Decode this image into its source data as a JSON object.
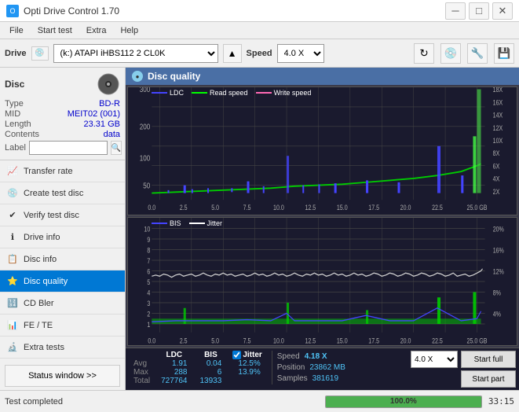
{
  "window": {
    "title": "Opti Drive Control 1.70",
    "icon": "disc"
  },
  "title_bar": {
    "controls": {
      "minimize": "─",
      "maximize": "□",
      "close": "✕"
    }
  },
  "menu": {
    "items": [
      "File",
      "Start test",
      "Extra",
      "Help"
    ]
  },
  "toolbar": {
    "drive_label": "Drive",
    "drive_icon": "💿",
    "drive_value": "(k:)  ATAPI iHBS112  2 CL0K",
    "speed_label": "Speed",
    "speed_value": "4.0 X"
  },
  "sidebar": {
    "disc_title": "Disc",
    "disc": {
      "type_label": "Type",
      "type_value": "BD-R",
      "mid_label": "MID",
      "mid_value": "MEIT02 (001)",
      "length_label": "Length",
      "length_value": "23.31 GB",
      "contents_label": "Contents",
      "contents_value": "data",
      "label_label": "Label",
      "label_placeholder": ""
    },
    "nav_items": [
      {
        "id": "transfer-rate",
        "label": "Transfer rate",
        "icon": "📈"
      },
      {
        "id": "create-test-disc",
        "label": "Create test disc",
        "icon": "💿"
      },
      {
        "id": "verify-test-disc",
        "label": "Verify test disc",
        "icon": "✔"
      },
      {
        "id": "drive-info",
        "label": "Drive info",
        "icon": "ℹ"
      },
      {
        "id": "disc-info",
        "label": "Disc info",
        "icon": "📋"
      },
      {
        "id": "disc-quality",
        "label": "Disc quality",
        "icon": "⭐",
        "active": true
      },
      {
        "id": "cd-bler",
        "label": "CD Bler",
        "icon": "🔢"
      },
      {
        "id": "fe-te",
        "label": "FE / TE",
        "icon": "📊"
      },
      {
        "id": "extra-tests",
        "label": "Extra tests",
        "icon": "🔬"
      }
    ],
    "status_btn": "Status window >>"
  },
  "disc_quality": {
    "title": "Disc quality",
    "chart1": {
      "legend": [
        {
          "label": "LDC",
          "color": "#0000ff"
        },
        {
          "label": "Read speed",
          "color": "#00ff00"
        },
        {
          "label": "Write speed",
          "color": "#ff69b4"
        }
      ],
      "y_max": 300,
      "y_labels_left": [
        "300",
        "200",
        "100",
        "50"
      ],
      "y_labels_right": [
        "18X",
        "16X",
        "14X",
        "12X",
        "10X",
        "8X",
        "6X",
        "4X",
        "2X"
      ],
      "x_labels": [
        "0.0",
        "2.5",
        "5.0",
        "7.5",
        "10.0",
        "12.5",
        "15.0",
        "17.5",
        "20.0",
        "22.5",
        "25.0 GB"
      ]
    },
    "chart2": {
      "legend": [
        {
          "label": "BIS",
          "color": "#0000ff"
        },
        {
          "label": "Jitter",
          "color": "#ffffff"
        }
      ],
      "y_max": 10,
      "y_labels_left": [
        "10",
        "9",
        "8",
        "7",
        "6",
        "5",
        "4",
        "3",
        "2",
        "1"
      ],
      "y_labels_right": [
        "20%",
        "16%",
        "12%",
        "8%",
        "4%"
      ],
      "x_labels": [
        "0.0",
        "2.5",
        "5.0",
        "7.5",
        "10.0",
        "12.5",
        "15.0",
        "17.5",
        "20.0",
        "22.5",
        "25.0 GB"
      ]
    },
    "stats": {
      "jitter_checked": true,
      "jitter_label": "Jitter",
      "ldc_label": "LDC",
      "bis_label": "BIS",
      "jitter_col_label": "Jitter",
      "speed_label": "Speed",
      "speed_value": "4.18 X",
      "speed_unit": "4.0 X",
      "avg_label": "Avg",
      "ldc_avg": "1.91",
      "bis_avg": "0.04",
      "jitter_avg": "12.5%",
      "max_label": "Max",
      "ldc_max": "288",
      "bis_max": "6",
      "jitter_max": "13.9%",
      "total_label": "Total",
      "ldc_total": "727764",
      "bis_total": "13933",
      "position_label": "Position",
      "position_value": "23862 MB",
      "samples_label": "Samples",
      "samples_value": "381619",
      "start_full_btn": "Start full",
      "start_part_btn": "Start part"
    }
  },
  "status_bar": {
    "text": "Test completed",
    "progress": "100.0%",
    "progress_value": 100,
    "time": "33:15"
  }
}
